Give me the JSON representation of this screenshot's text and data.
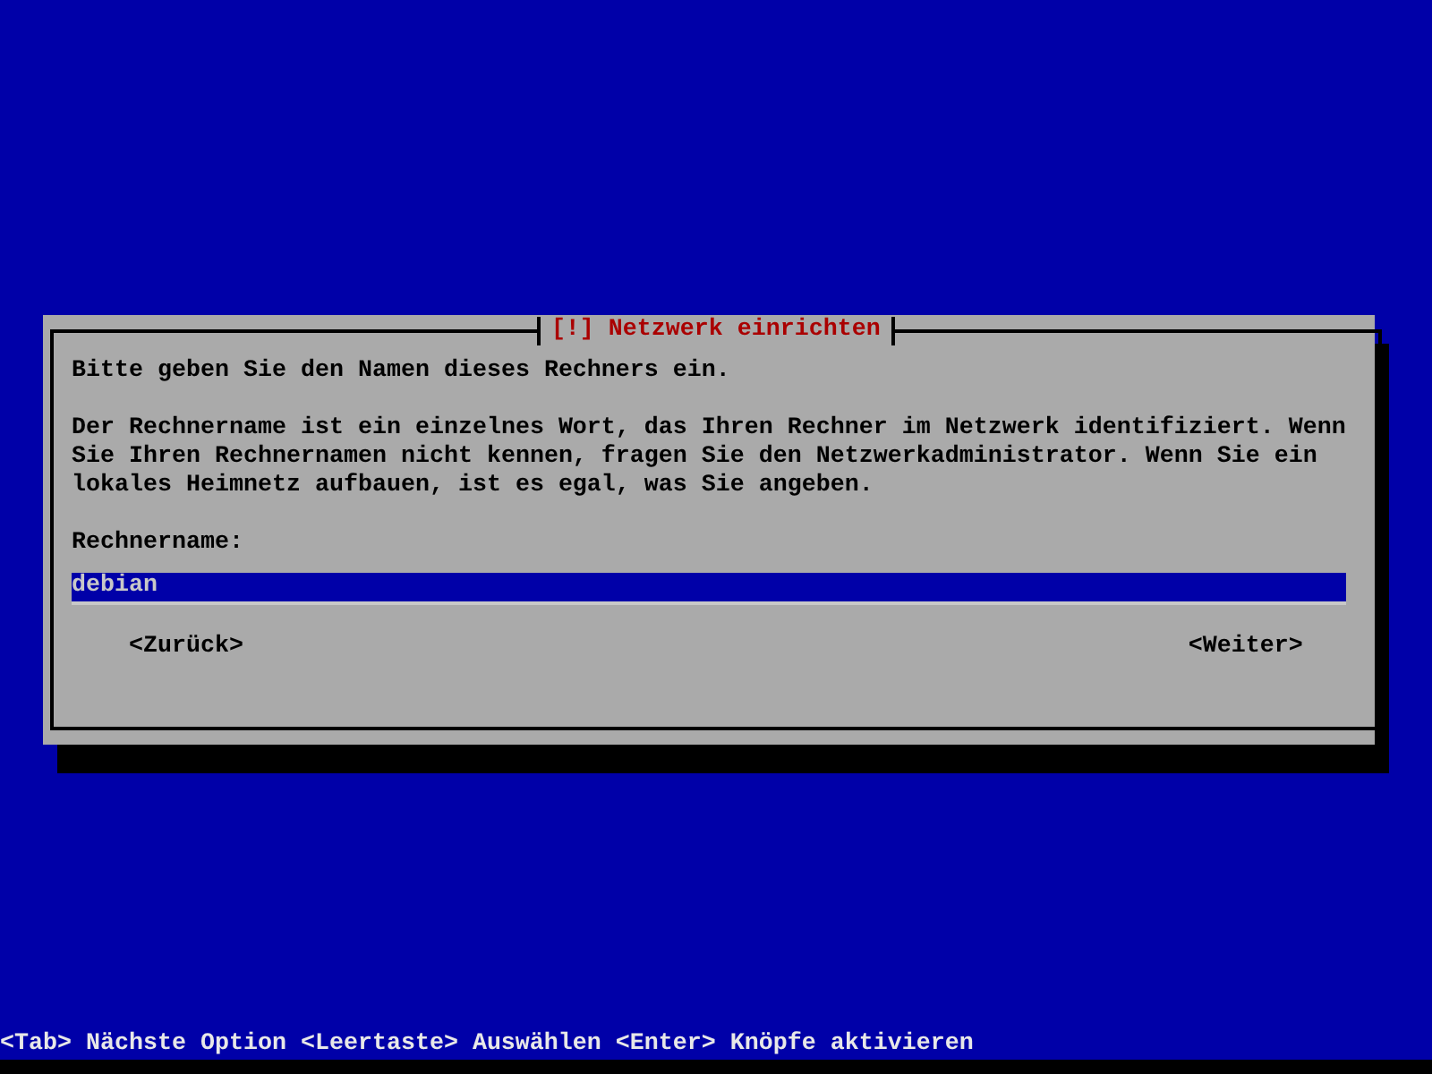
{
  "dialog": {
    "title": "[!] Netzwerk einrichten",
    "prompt": "Bitte geben Sie den Namen dieses Rechners ein.",
    "description": "Der Rechnername ist ein einzelnes Wort, das Ihren Rechner im Netzwerk identifiziert. Wenn Sie Ihren Rechnernamen nicht kennen, fragen Sie den Netzwerkadministrator. Wenn Sie ein lokales Heimnetz aufbauen, ist es egal, was Sie angeben.",
    "field": {
      "label": "Rechnername:",
      "value": "debian"
    },
    "buttons": [
      {
        "label": "<Zurück>"
      },
      {
        "label": "<Weiter>"
      }
    ]
  },
  "status_bar": "<Tab> Nächste Option <Leertaste> Auswählen <Enter> Knöpfe aktivieren"
}
